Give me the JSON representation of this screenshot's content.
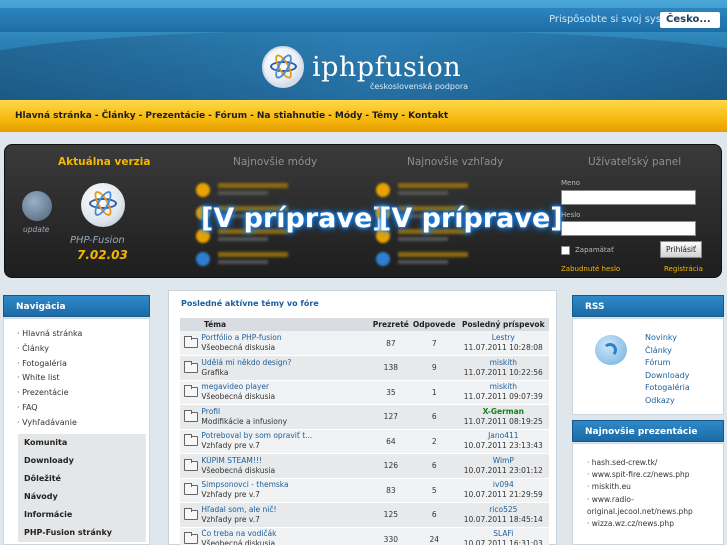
{
  "topbar": {
    "message": "Prispôsobte si svoj systém",
    "language": "Česko..."
  },
  "logo": {
    "text": "iphpfusion",
    "subtitle": "československá podpora"
  },
  "mainnav": [
    "Hlavná stránka",
    "Články",
    "Prezentácie",
    "Fórum",
    "Na stiahnutie",
    "Módy",
    "Témy",
    "Kontakt"
  ],
  "panel": {
    "version": {
      "title": "Aktuálna verzia",
      "update_label": "update",
      "name": "PHP-Fusion",
      "number": "7.02.03"
    },
    "mods": {
      "title": "Najnovšie módy",
      "status": "[V príprave]"
    },
    "themes": {
      "title": "Najnovšie vzhľady",
      "status": "[V príprave]"
    },
    "user": {
      "title": "Užívateľský panel",
      "username_label": "Meno",
      "password_label": "Heslo",
      "remember_label": "Zapamätať",
      "login_button": "Prihlásiť",
      "forgot_link": "Zabudnuté heslo",
      "register_link": "Registrácia"
    }
  },
  "left": {
    "title": "Navigácia",
    "links": [
      "· Hlavná stránka",
      "· Články",
      "· Fotogaléria",
      "· White list",
      "· Prezentácie",
      "· FAQ",
      "· Vyhľadávanie"
    ],
    "groups": [
      "Komunita",
      "Downloady",
      "Dôležité",
      "Návody",
      "Informácie",
      "PHP-Fusion stránky"
    ]
  },
  "forum": {
    "title": "Posledné aktívne témy vo fóre",
    "headers": {
      "topic": "Téma",
      "views": "Prezreté",
      "replies": "Odpovede",
      "last": "Posledný príspevok"
    },
    "rows": [
      {
        "title": "Portfólio a PHP-fusion",
        "forum": "Všeobecná diskusia",
        "views": "87",
        "replies": "7",
        "user": "Lestry",
        "date": "11.07.2011 10:28:08",
        "admin": false
      },
      {
        "title": "Udělá mi někdo design?",
        "forum": "Grafika",
        "views": "138",
        "replies": "9",
        "user": "miskith",
        "date": "11.07.2011 10:22:56",
        "admin": false
      },
      {
        "title": "megavideo player",
        "forum": "Všeobecná diskusia",
        "views": "35",
        "replies": "1",
        "user": "miskith",
        "date": "11.07.2011 09:07:39",
        "admin": false
      },
      {
        "title": "Profil",
        "forum": "Modifikácie a infusiony",
        "views": "127",
        "replies": "6",
        "user": "X-German",
        "date": "11.07.2011 08:19:25",
        "admin": true
      },
      {
        "title": "Potreboval by som opraviť t...",
        "forum": "Vzhľady pre v.7",
        "views": "64",
        "replies": "2",
        "user": "Jano411",
        "date": "10.07.2011 23:13:43",
        "admin": false
      },
      {
        "title": "KÚPIM STEAM!!!",
        "forum": "Všeobecná diskusia",
        "views": "126",
        "replies": "6",
        "user": "WimP",
        "date": "10.07.2011 23:01:12",
        "admin": false
      },
      {
        "title": "Simpsonovci - themska",
        "forum": "Vzhľady pre v.7",
        "views": "83",
        "replies": "5",
        "user": "iv094",
        "date": "10.07.2011 21:29:59",
        "admin": false
      },
      {
        "title": "Hľadal som, ale nič!",
        "forum": "Vzhľady pre v.7",
        "views": "125",
        "replies": "6",
        "user": "rico525",
        "date": "10.07.2011 18:45:14",
        "admin": false
      },
      {
        "title": "Čo treba na vodičák",
        "forum": "Všeobecná diskusia",
        "views": "330",
        "replies": "24",
        "user": "SLAFi",
        "date": "10.07.2011 16:31:03",
        "admin": false
      }
    ]
  },
  "rss": {
    "title": "RSS",
    "links": [
      "Novinky",
      "Články",
      "Fórum",
      "Downloady",
      "Fotogaléria",
      "Odkazy"
    ]
  },
  "presentations": {
    "title": "Najnovšie prezentácie",
    "items": [
      "· hash.sed-crew.tk/",
      "· www.spit-fire.cz/news.php",
      "· miskith.eu",
      "· www.radio-",
      "original.jecool.net/news.php",
      "· wizza.wz.cz/news.php"
    ]
  }
}
